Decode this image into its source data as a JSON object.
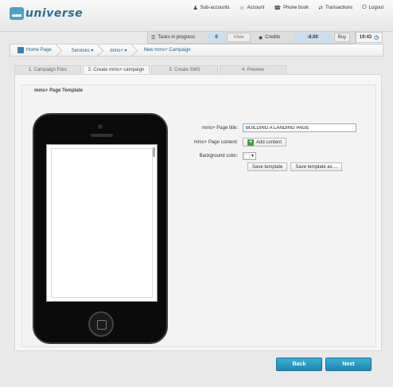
{
  "app": {
    "logo_text": "universe"
  },
  "toplinks": [
    {
      "icon": "people-icon",
      "glyph": "♟",
      "label": "Sub-accounts"
    },
    {
      "icon": "user-icon",
      "glyph": "☺",
      "label": "Account"
    },
    {
      "icon": "phonebook-icon",
      "glyph": "☎",
      "label": "Phone book"
    },
    {
      "icon": "transactions-icon",
      "glyph": "⇄",
      "label": "Transactions"
    },
    {
      "icon": "power-icon",
      "glyph": "⏻",
      "label": "Logout"
    }
  ],
  "status": {
    "tasks_label": "Tasks in progress",
    "tasks_count": "0",
    "view_label": "View",
    "credits_label": "Credits",
    "credits_value": "-8.00",
    "buy_label": "Buy",
    "time": "19:43"
  },
  "breadcrumb": {
    "home": "Home Page",
    "services": "Services ▾",
    "mms": "mms+ ▾",
    "current": "New mms+ Campaign"
  },
  "steps": [
    {
      "label": "1. Campaign Files",
      "active": false
    },
    {
      "label": "2. Create mms+ campaign",
      "active": true
    },
    {
      "label": "3. Create SMS",
      "active": false
    },
    {
      "label": "4. Preview",
      "active": false
    }
  ],
  "section": {
    "title": "mms+ Page Template"
  },
  "form": {
    "page_title_label": "mms+ Page title:",
    "page_title_value": "BUILDING A LANDING PAGE",
    "page_content_label": "mms+ Page content:",
    "add_content_label": "Add content",
    "background_color_label": "Background color:",
    "background_color_value": "#ffffff",
    "save_template_label": "Save template",
    "save_template_as_label": "Save template as ..."
  },
  "nav": {
    "back_label": "Back",
    "next_label": "Next"
  },
  "colors": {
    "accent": "#1f8ab5",
    "link": "#23628a",
    "credits_bg": "#c9def0"
  }
}
